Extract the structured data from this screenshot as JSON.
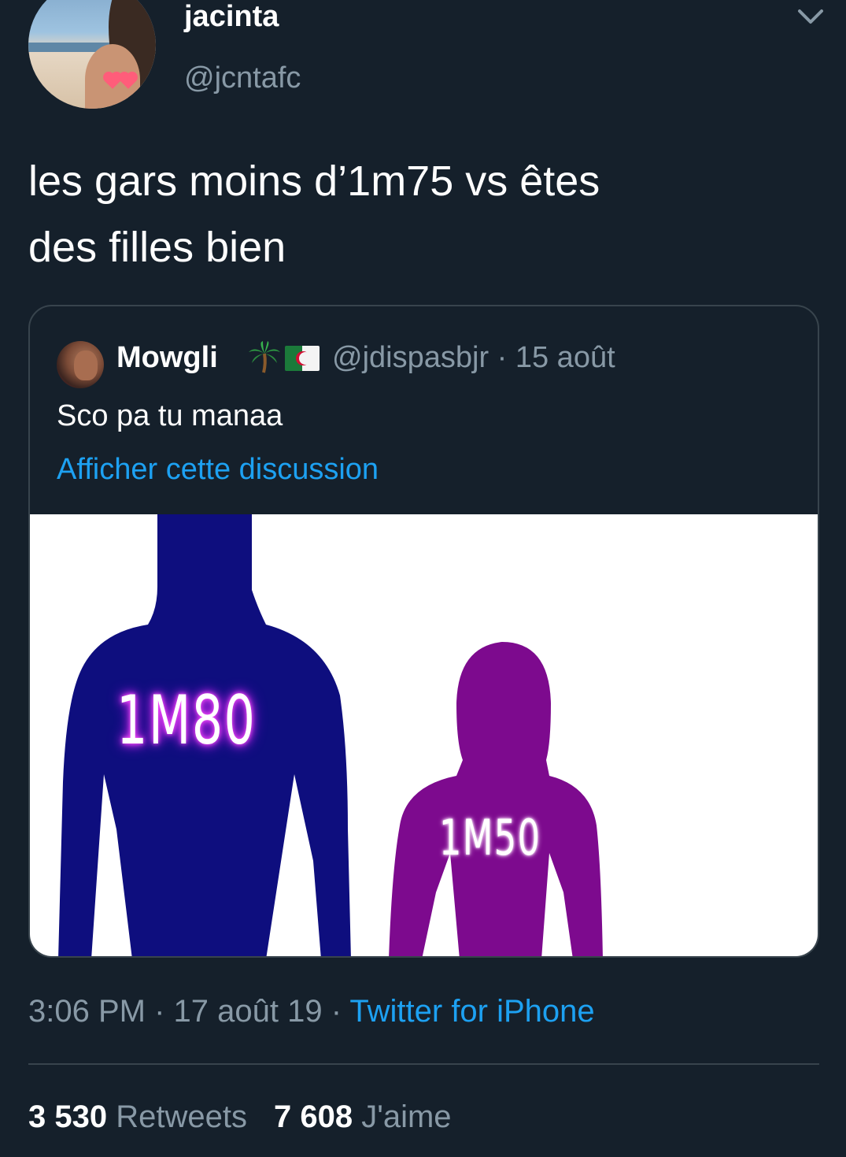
{
  "author": {
    "display_name": "jacinta",
    "handle": "@jcntafc"
  },
  "tweet": {
    "text_line1": "les gars moins d’1m75 vs êtes",
    "text_line2": "des filles bien"
  },
  "quoted": {
    "display_name": "Mowgli",
    "emojis": [
      "palm-tree",
      "algeria-flag"
    ],
    "handle_date": "@jdispasbjr · 15 août",
    "text": "Sco pa tu manaa",
    "show_thread_link": "Afficher cette discussion",
    "image": {
      "label_tall": "1M80",
      "label_short": "1M50",
      "colors": {
        "tall_figure": "#0e0e7e",
        "short_figure": "#7d0a8e",
        "background": "#ffffff"
      }
    }
  },
  "meta": {
    "time": "3:06 PM",
    "date": "17 août 19",
    "separator": " · ",
    "source": "Twitter for iPhone"
  },
  "stats": {
    "retweets_count": "3 530",
    "retweets_label": "Retweets",
    "likes_count": "7 608",
    "likes_label": "J'aime"
  },
  "colors": {
    "background": "#15202b",
    "secondary_text": "#8899a6",
    "link": "#1da1f2",
    "border": "#38444d"
  }
}
